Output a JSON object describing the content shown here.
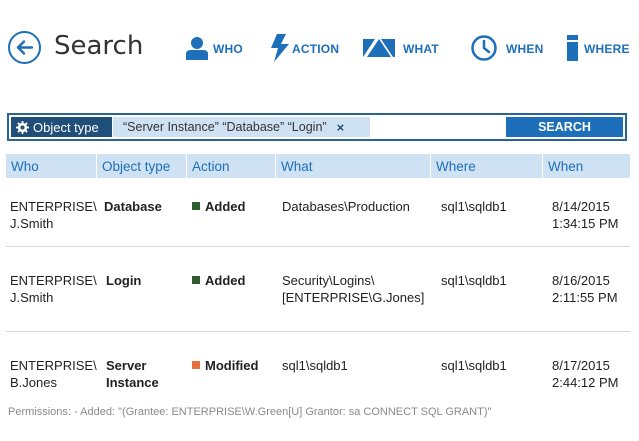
{
  "header": {
    "title": "Search",
    "back_icon": "back-arrow-icon",
    "filters": {
      "who": {
        "label": "WHO",
        "icon": "person-icon"
      },
      "action": {
        "label": "ACTION",
        "icon": "lightning-icon"
      },
      "what": {
        "label": "WHAT",
        "icon": "shapes-icon"
      },
      "when": {
        "label": "WHEN",
        "icon": "clock-icon"
      },
      "where": {
        "label": "WHERE",
        "icon": "server-icon"
      }
    },
    "accent_color": "#1c6fb8"
  },
  "search": {
    "type_label": "Object type",
    "type_values": "“Server Instance” “Database” “Login”",
    "remove_glyph": "×",
    "button_label": "SEARCH"
  },
  "table": {
    "columns": [
      "Who",
      "Object type",
      "Action",
      "What",
      "Where",
      "When"
    ],
    "rows": [
      {
        "who": [
          "ENTERPRISE\\",
          "J.Smith"
        ],
        "object_type": [
          "Database"
        ],
        "action": "Added",
        "action_color": "#2e5e2e",
        "what": [
          "Databases\\Production"
        ],
        "where": "sql1\\sqldb1",
        "when": [
          "8/14/2015",
          "1:34:15 PM"
        ]
      },
      {
        "who": [
          "ENTERPRISE\\",
          "J.Smith"
        ],
        "object_type": [
          "Login"
        ],
        "action": "Added",
        "action_color": "#2e5e2e",
        "what": [
          "Security\\Logins\\",
          "[ENTERPRISE\\G.Jones]"
        ],
        "where": "sql1\\sqldb1",
        "when": [
          "8/16/2015",
          "2:11:55 PM"
        ]
      },
      {
        "who": [
          "ENTERPRISE\\",
          "B.Jones"
        ],
        "object_type": [
          "Server",
          "Instance"
        ],
        "action": "Modified",
        "action_color": "#e8703a",
        "what": [
          "sql1\\sqldb1"
        ],
        "where": "sql1\\sqldb1",
        "when": [
          "8/17/2015",
          "2:44:12 PM"
        ]
      }
    ]
  },
  "details": {
    "permissions_text": "Permissions: - Added: \"(Grantee: ENTERPRISE\\W.Green[U] Grantor: sa CONNECT SQL GRANT)\""
  }
}
